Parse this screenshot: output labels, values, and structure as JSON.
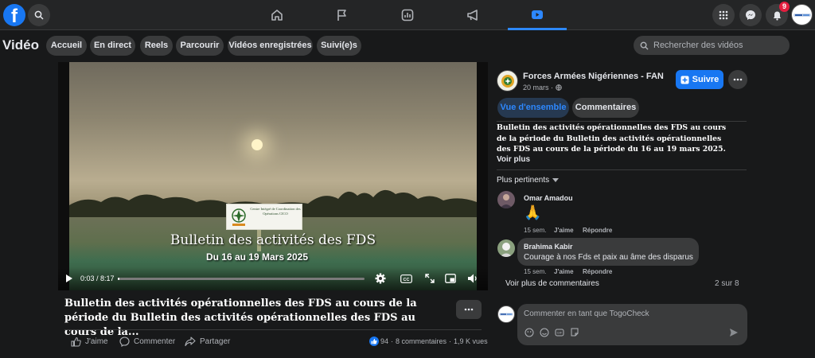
{
  "topbar": {
    "notifications_count": "9",
    "nav": [
      "home-icon",
      "flag-icon",
      "groups-icon",
      "megaphone-icon",
      "video-icon"
    ],
    "active_nav": "video-icon"
  },
  "subbar": {
    "title": "Vidéo",
    "pills": [
      "Accueil",
      "En direct",
      "Reels",
      "Parcourir",
      "Vidéos enregistrées",
      "Suivi(e)s"
    ],
    "search_placeholder": "Rechercher des vidéos"
  },
  "player": {
    "logo_text": "Centre Intégré de Coordination des Opérations CICO",
    "logo_short": "CICO",
    "overlay_title": "Bulletin des activités des FDS",
    "overlay_date": "Du 16 au 19 Mars 2025",
    "time": "0:03 / 8:17",
    "progress": 0.006
  },
  "post": {
    "title": "Bulletin des activités opérationnelles des FDS au cours de la période du Bulletin des activités opérationnelles des FDS au cours de la...",
    "actions": {
      "like": "J'aime",
      "comment": "Commenter",
      "share": "Partager"
    },
    "reactions": "94",
    "comments_count": "8 commentaires",
    "views": "1,9 K vues"
  },
  "page": {
    "name": "Forces Armées Nigériennes - FAN",
    "date": "20 mars ·",
    "follow_label": "Suivre"
  },
  "tabs": [
    "Vue d'ensemble",
    "Commentaires"
  ],
  "description": "Bulletin des activités opérationnelles des FDS au cours de la période du Bulletin des activités opérationnelles des FDS au cours de la période du 16 au 19 mars 2025.",
  "voir_plus": "Voir plus",
  "sort_label": "Plus pertinents",
  "comments": [
    {
      "author": "Omar Amadou",
      "text": "🙏",
      "age": "15 sem.",
      "like": "J'aime",
      "reply": "Répondre"
    },
    {
      "author": "Brahima Kabir",
      "text": "Courage à nos Fds et paix au âme des disparus",
      "age": "15 sem.",
      "like": "J'aime",
      "reply": "Répondre"
    }
  ],
  "more_comments": "Voir plus de commentaires",
  "comments_pager": "2 sur 8",
  "compose_placeholder": "Commenter en tant que TogoCheck",
  "colors": {
    "accent": "#1877f2",
    "background": "#18191a",
    "surface": "#242526",
    "pill": "#3a3b3c"
  }
}
